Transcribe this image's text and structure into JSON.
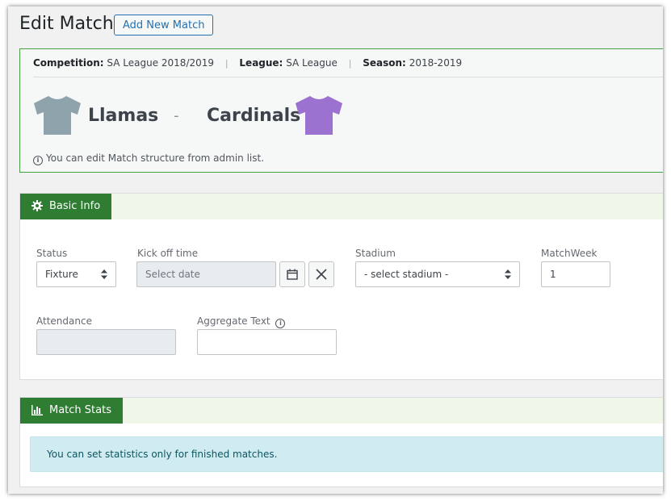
{
  "page": {
    "title": "Edit Match",
    "add_new_label": "Add New Match"
  },
  "match": {
    "competition_label": "Competition:",
    "competition": "SA League 2018/2019",
    "league_label": "League:",
    "league": "SA League",
    "season_label": "Season:",
    "season": "2018-2019",
    "separator": "|",
    "home_team": "Llamas",
    "away_team": "Cardinals",
    "dash": "-",
    "home_shirt_color": "#8fa3ad",
    "away_shirt_color": "#9b72cf",
    "note": "You can edit Match structure from admin list."
  },
  "basic_info": {
    "tab_label": "Basic Info",
    "status_label": "Status",
    "status_value": "Fixture",
    "kickoff_label": "Kick off time",
    "kickoff_placeholder": "Select date",
    "stadium_label": "Stadium",
    "stadium_value": "- select stadium -",
    "matchweek_label": "MatchWeek",
    "matchweek_value": "1",
    "attendance_label": "Attendance",
    "attendance_value": "",
    "aggregate_label": "Aggregate Text",
    "aggregate_value": ""
  },
  "match_stats": {
    "tab_label": "Match Stats",
    "message": "You can set statistics only for finished matches."
  },
  "colors": {
    "accent_green": "#2e7d32",
    "link_blue": "#2271b1",
    "info_bg": "#d1ecf1"
  }
}
